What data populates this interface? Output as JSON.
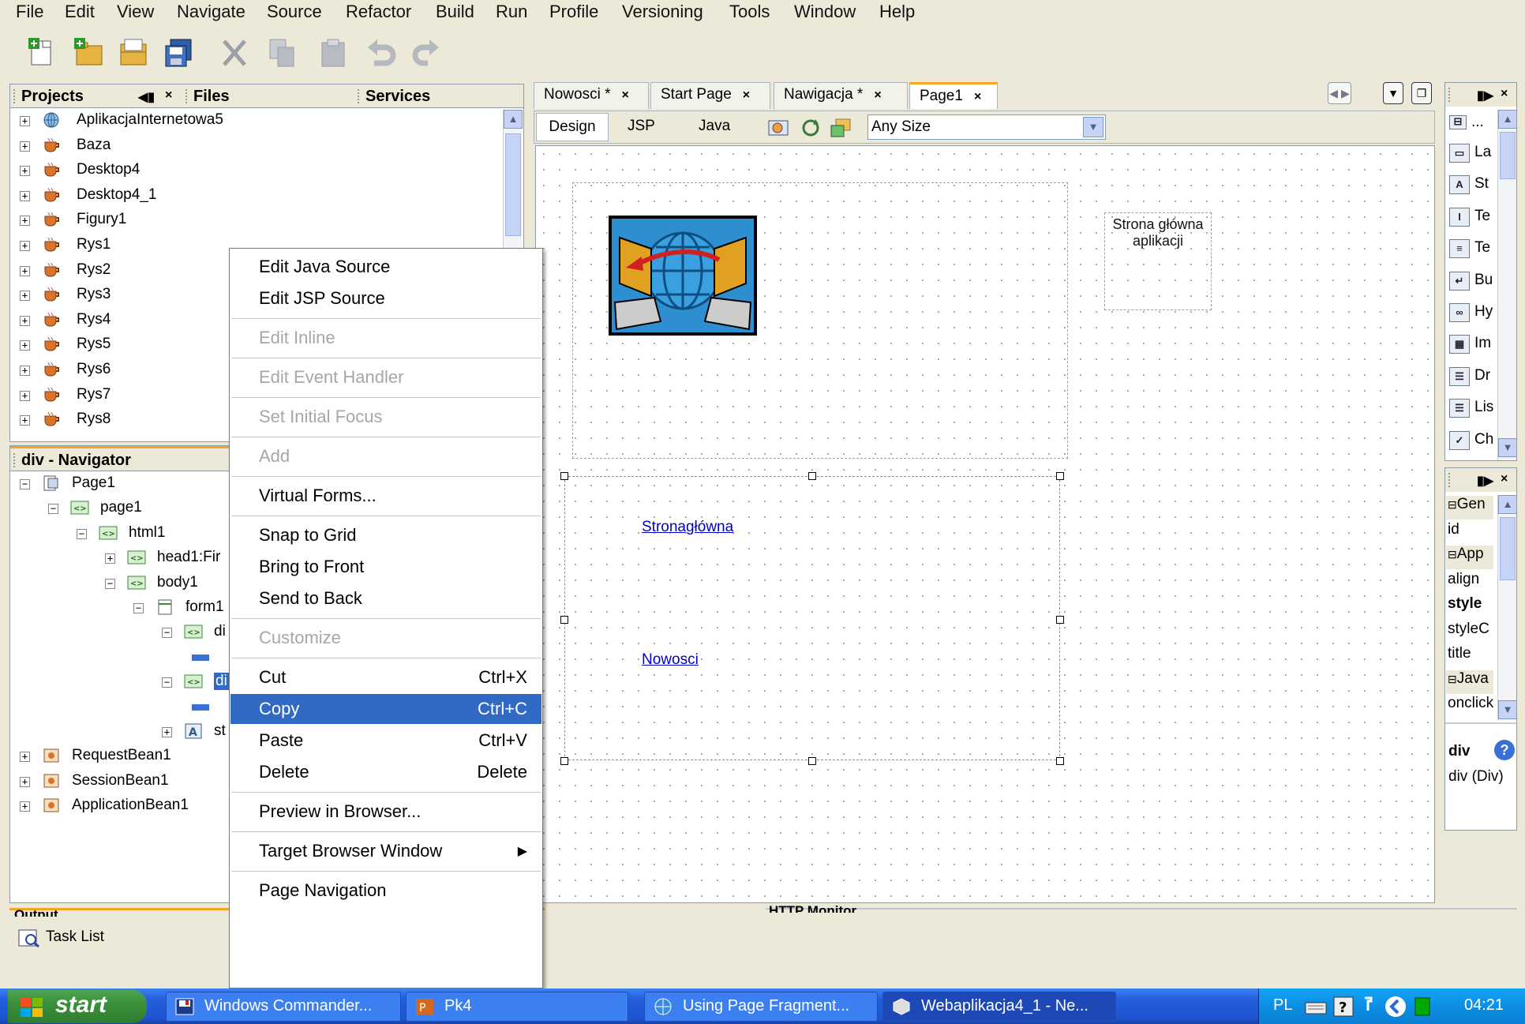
{
  "menu": [
    "File",
    "Edit",
    "View",
    "Navigate",
    "Source",
    "Refactor",
    "Build",
    "Run",
    "Profile",
    "Versioning",
    "Tools",
    "Window",
    "Help"
  ],
  "projects_panel": {
    "tabs": [
      "Projects",
      "Files",
      "Services"
    ],
    "items": [
      "AplikacjaInternetowa5",
      "Baza",
      "Desktop4",
      "Desktop4_1",
      "Figury1",
      "Rys1",
      "Rys2",
      "Rys3",
      "Rys4",
      "Rys5",
      "Rys6",
      "Rys7",
      "Rys8"
    ]
  },
  "navigator": {
    "title": "div - Navigator",
    "items": [
      "Page1",
      "page1",
      "html1",
      "head1:Fir",
      "body1",
      "form1",
      "di",
      "di",
      "st",
      "RequestBean1",
      "SessionBean1",
      "ApplicationBean1"
    ]
  },
  "editor": {
    "tabs": [
      {
        "label": "Nowosci *"
      },
      {
        "label": "Start Page"
      },
      {
        "label": "Nawigacja *"
      },
      {
        "label": "Page1"
      }
    ],
    "view_tabs": [
      "Design",
      "JSP",
      "Java"
    ],
    "size_select": "Any Size",
    "header_text_line1": "Strona główna",
    "header_text_line2": "aplikacji",
    "link1": "Stronagłówna",
    "link2": "Nowosci"
  },
  "context_menu": {
    "items": [
      {
        "label": "Edit Java Source",
        "shortcut": ""
      },
      {
        "label": "Edit JSP Source",
        "shortcut": ""
      },
      {
        "label": "Edit Inline",
        "shortcut": ""
      },
      {
        "label": "Edit Event Handler",
        "shortcut": ""
      },
      {
        "label": "Set Initial Focus",
        "shortcut": ""
      },
      {
        "label": "Add",
        "shortcut": ""
      },
      {
        "label": "Virtual Forms...",
        "shortcut": ""
      },
      {
        "label": "Snap to Grid",
        "shortcut": ""
      },
      {
        "label": "Bring to Front",
        "shortcut": ""
      },
      {
        "label": "Send to Back",
        "shortcut": ""
      },
      {
        "label": "Customize",
        "shortcut": ""
      },
      {
        "label": "Cut",
        "shortcut": "Ctrl+X"
      },
      {
        "label": "Copy",
        "shortcut": "Ctrl+C"
      },
      {
        "label": "Paste",
        "shortcut": "Ctrl+V"
      },
      {
        "label": "Delete",
        "shortcut": "Delete"
      },
      {
        "label": "Preview in Browser...",
        "shortcut": ""
      },
      {
        "label": "Target Browser Window",
        "shortcut": ""
      },
      {
        "label": "Page Navigation",
        "shortcut": ""
      }
    ]
  },
  "palette": {
    "items": [
      "La",
      "St",
      "Te",
      "Te",
      "Bu",
      "Hy",
      "Im",
      "Dr",
      "Lis",
      "Ch"
    ]
  },
  "properties": {
    "items": [
      "Gen",
      "id",
      "App",
      "align",
      "style",
      "styleC",
      "title",
      "Java",
      "onclick"
    ],
    "footer_title": "div",
    "footer_desc": "div (Div)"
  },
  "bottom": {
    "output_tab": "Output",
    "task_list": "Task List",
    "http_tab": "HTTP Monitor"
  },
  "taskbar": {
    "start": "start",
    "tasks": [
      "Windows Commander...",
      "Pk4",
      "Using Page Fragment...",
      "Webaplikacja4_1 - Ne..."
    ],
    "lang": "PL",
    "clock": "04:21"
  }
}
